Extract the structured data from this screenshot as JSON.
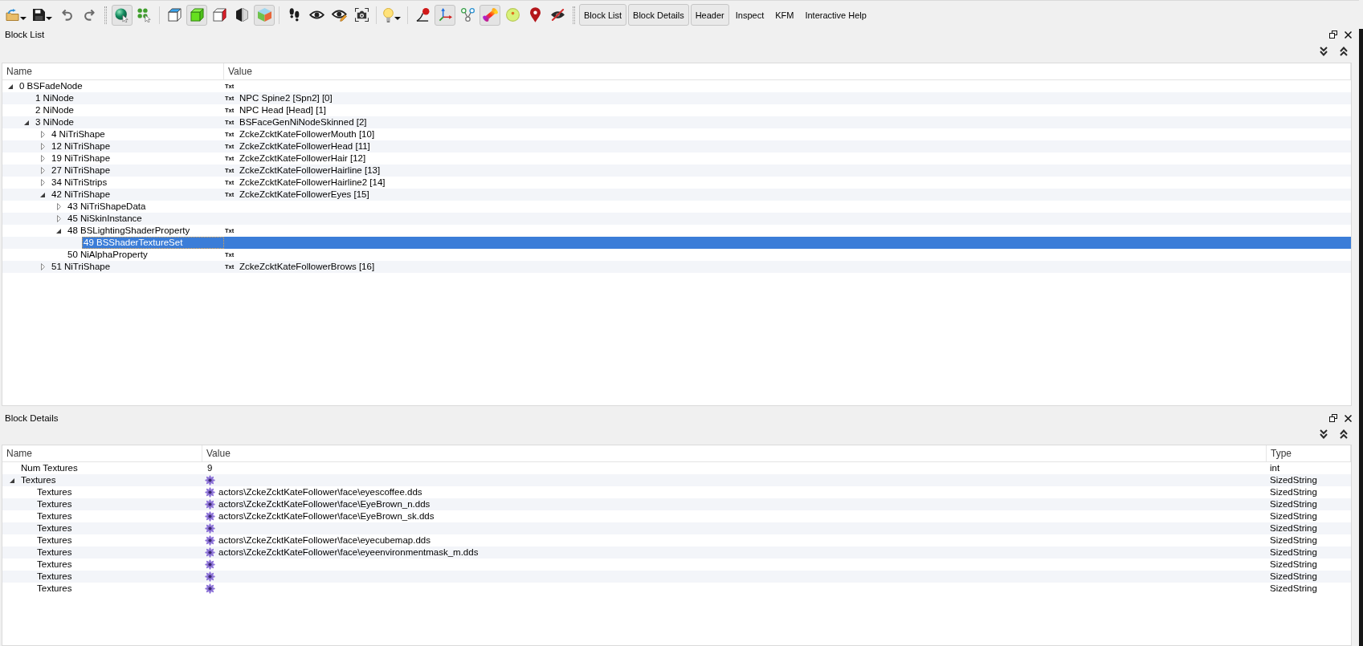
{
  "toolbar": {
    "groups": [
      {
        "items": [
          {
            "kind": "open",
            "dropdown": true,
            "pressed": false
          },
          {
            "kind": "save",
            "dropdown": true,
            "pressed": false
          },
          {
            "kind": "undo",
            "dropdown": false,
            "pressed": false
          },
          {
            "kind": "redo",
            "dropdown": false,
            "pressed": false
          }
        ]
      },
      {
        "grip": true,
        "items": [
          {
            "kind": "select",
            "dropdown": false,
            "pressed": true
          },
          {
            "kind": "vertices",
            "dropdown": false,
            "pressed": false
          }
        ]
      },
      {
        "grip": false,
        "items": [
          {
            "kind": "wireframe",
            "dropdown": false,
            "pressed": false
          },
          {
            "kind": "solid",
            "dropdown": false,
            "pressed": true
          },
          {
            "kind": "flat",
            "dropdown": false,
            "pressed": false
          },
          {
            "kind": "backface",
            "dropdown": false,
            "pressed": false
          },
          {
            "kind": "textured",
            "dropdown": false,
            "pressed": true
          }
        ]
      },
      {
        "grip": false,
        "items": [
          {
            "kind": "walk",
            "dropdown": false,
            "pressed": false
          },
          {
            "kind": "view",
            "dropdown": false,
            "pressed": false
          },
          {
            "kind": "edit",
            "dropdown": false,
            "pressed": false
          },
          {
            "kind": "screenshot",
            "dropdown": false,
            "pressed": false
          }
        ]
      },
      {
        "grip": false,
        "items": [
          {
            "kind": "light",
            "dropdown": true,
            "pressed": false
          }
        ]
      },
      {
        "grip": false,
        "items": [
          {
            "kind": "curve",
            "dropdown": false,
            "pressed": false
          },
          {
            "kind": "axes",
            "dropdown": false,
            "pressed": true
          },
          {
            "kind": "nodes",
            "dropdown": false,
            "pressed": false
          },
          {
            "kind": "bone",
            "dropdown": false,
            "pressed": true
          },
          {
            "kind": "target",
            "dropdown": false,
            "pressed": false
          },
          {
            "kind": "pin",
            "dropdown": false,
            "pressed": false
          },
          {
            "kind": "hide",
            "dropdown": false,
            "pressed": false
          }
        ]
      }
    ],
    "view_buttons": {
      "grip": true,
      "items": [
        {
          "label": "Block List",
          "pressed": true
        },
        {
          "label": "Block Details",
          "pressed": true
        },
        {
          "label": "Header",
          "pressed": true
        },
        {
          "label": "Inspect",
          "pressed": false
        },
        {
          "label": "KFM",
          "pressed": false
        },
        {
          "label": "Interactive Help",
          "pressed": false
        }
      ]
    }
  },
  "block_list": {
    "title": "Block List",
    "columns": [
      "Name",
      "Value"
    ],
    "rows": [
      {
        "label": "0 BSFadeNode",
        "tag": "Txt",
        "expanded": true,
        "selected": false,
        "children": [
          {
            "label": "1 NiNode",
            "tag": "Txt",
            "value": "NPC Spine2 [Spn2] [0]",
            "selected": false
          },
          {
            "label": "2 NiNode",
            "tag": "Txt",
            "value": "NPC Head [Head] [1]",
            "selected": false
          },
          {
            "label": "3 NiNode",
            "tag": "Txt",
            "value": "BSFaceGenNiNodeSkinned [2]",
            "expanded": true,
            "selected": false,
            "children": [
              {
                "label": "4 NiTriShape",
                "tag": "Txt",
                "value": "ZckeZcktKateFollowerMouth [10]",
                "expanded": false,
                "selected": false
              },
              {
                "label": "12 NiTriShape",
                "tag": "Txt",
                "value": "ZckeZcktKateFollowerHead [11]",
                "expanded": false,
                "selected": false
              },
              {
                "label": "19 NiTriShape",
                "tag": "Txt",
                "value": "ZckeZcktKateFollowerHair [12]",
                "expanded": false,
                "selected": false
              },
              {
                "label": "27 NiTriShape",
                "tag": "Txt",
                "value": "ZckeZcktKateFollowerHairline [13]",
                "expanded": false,
                "selected": false
              },
              {
                "label": "34 NiTriStrips",
                "tag": "Txt",
                "value": "ZckeZcktKateFollowerHairline2 [14]",
                "expanded": false,
                "selected": false
              },
              {
                "label": "42 NiTriShape",
                "tag": "Txt",
                "value": "ZckeZcktKateFollowerEyes [15]",
                "expanded": true,
                "selected": false,
                "children": [
                  {
                    "label": "43 NiTriShapeData",
                    "expanded": false,
                    "selected": false
                  },
                  {
                    "label": "45 NiSkinInstance",
                    "expanded": false,
                    "selected": false
                  },
                  {
                    "label": "48 BSLightingShaderProperty",
                    "tag": "Txt",
                    "expanded": true,
                    "selected": false,
                    "children": [
                      {
                        "label": "49 BSShaderTextureSet",
                        "selected": true
                      }
                    ]
                  },
                  {
                    "label": "50 NiAlphaProperty",
                    "tag": "Txt",
                    "selected": false
                  }
                ]
              },
              {
                "label": "51 NiTriShape",
                "tag": "Txt",
                "value": "ZckeZcktKateFollowerBrows [16]",
                "expanded": false,
                "selected": false
              }
            ]
          }
        ]
      }
    ]
  },
  "block_details": {
    "title": "Block Details",
    "columns": [
      "Name",
      "Value",
      "Type"
    ],
    "rows": [
      {
        "kind": "number",
        "name": "Num Textures",
        "value": "9",
        "type": "int"
      },
      {
        "kind": "string",
        "name": "Textures",
        "type": "SizedString",
        "expanded": true,
        "children": [
          {
            "kind": "string",
            "name": "Textures",
            "value": "actors\\ZckeZcktKateFollower\\face\\eyescoffee.dds",
            "type": "SizedString"
          },
          {
            "kind": "string",
            "name": "Textures",
            "value": "actors\\ZckeZcktKateFollower\\face\\EyeBrown_n.dds",
            "type": "SizedString"
          },
          {
            "kind": "string",
            "name": "Textures",
            "value": "actors\\ZckeZcktKateFollower\\face\\EyeBrown_sk.dds",
            "type": "SizedString"
          },
          {
            "kind": "string",
            "name": "Textures",
            "type": "SizedString"
          },
          {
            "kind": "string",
            "name": "Textures",
            "value": "actors\\ZckeZcktKateFollower\\face\\eyecubemap.dds",
            "type": "SizedString"
          },
          {
            "kind": "string",
            "name": "Textures",
            "value": "actors\\ZckeZcktKateFollower\\face\\eyeenvironmentmask_m.dds",
            "type": "SizedString"
          },
          {
            "kind": "string",
            "name": "Textures",
            "type": "SizedString"
          },
          {
            "kind": "string",
            "name": "Textures",
            "type": "SizedString"
          },
          {
            "kind": "string",
            "name": "Textures",
            "type": "SizedString"
          }
        ]
      }
    ]
  }
}
